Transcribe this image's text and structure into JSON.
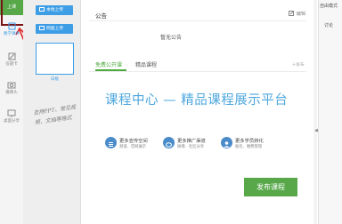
{
  "sidebar": {
    "upload_label": "上课",
    "items": [
      {
        "label": "教学课件",
        "icon": "courseware-icon"
      },
      {
        "label": "答题卡",
        "icon": "answer-card-icon"
      },
      {
        "label": "摄像头",
        "icon": "camera-icon"
      },
      {
        "label": "桌面分享",
        "icon": "desktop-share-icon"
      }
    ]
  },
  "files": {
    "local_upload_label": "本地上传",
    "cloud_upload_label": "网盘上传",
    "whiteboard_label": "白板",
    "handwritten_note": "支持PPT、常见视频、文档等格式"
  },
  "notice": {
    "title": "公告",
    "edit_label": "编辑",
    "empty_text": "暂无公告"
  },
  "tabs": [
    {
      "label": "免费公开课",
      "active": true
    },
    {
      "label": "精品课程",
      "active": false
    }
  ],
  "publish_link": "+发布",
  "promo": {
    "headline": "课程中心 — 精品课程展示平台",
    "features": [
      {
        "title": "更多宣传空间",
        "desc": "频道、官网展示",
        "icon": "list-icon"
      },
      {
        "title": "更多推广渠道",
        "desc": "微博、社区分享",
        "icon": "weibo-icon"
      },
      {
        "title": "更多学员转化",
        "desc": "报名、缴费管理",
        "icon": "user-icon"
      }
    ],
    "publish_button": "发布课程"
  },
  "right_panel": {
    "title": "自由模式",
    "label": "讨论"
  },
  "colors": {
    "green": "#58a84a",
    "blue": "#3d9ee6",
    "headline": "#4ea8de",
    "highlight": "#7a1515"
  }
}
